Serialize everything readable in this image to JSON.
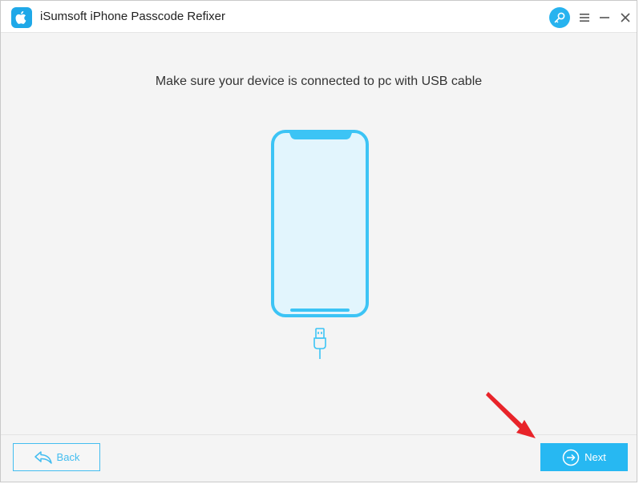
{
  "window": {
    "title": "iSumsoft iPhone Passcode Refixer",
    "app_icon": "apple-logo-icon",
    "controls": [
      "key-icon",
      "menu-icon",
      "minimize-icon",
      "close-icon"
    ]
  },
  "main": {
    "instruction": "Make sure your device is connected to pc with USB cable",
    "illustration": [
      "phone-outline-icon",
      "usb-cable-icon"
    ]
  },
  "footer": {
    "back_label": "Back",
    "next_label": "Next"
  },
  "annotation": {
    "arrow": "red-pointer-arrow-icon"
  },
  "colors": {
    "accent": "#27b8f2",
    "phone_stroke": "#3cc4f5",
    "phone_fill": "#e2f5fd",
    "arrow": "#e8242a"
  }
}
